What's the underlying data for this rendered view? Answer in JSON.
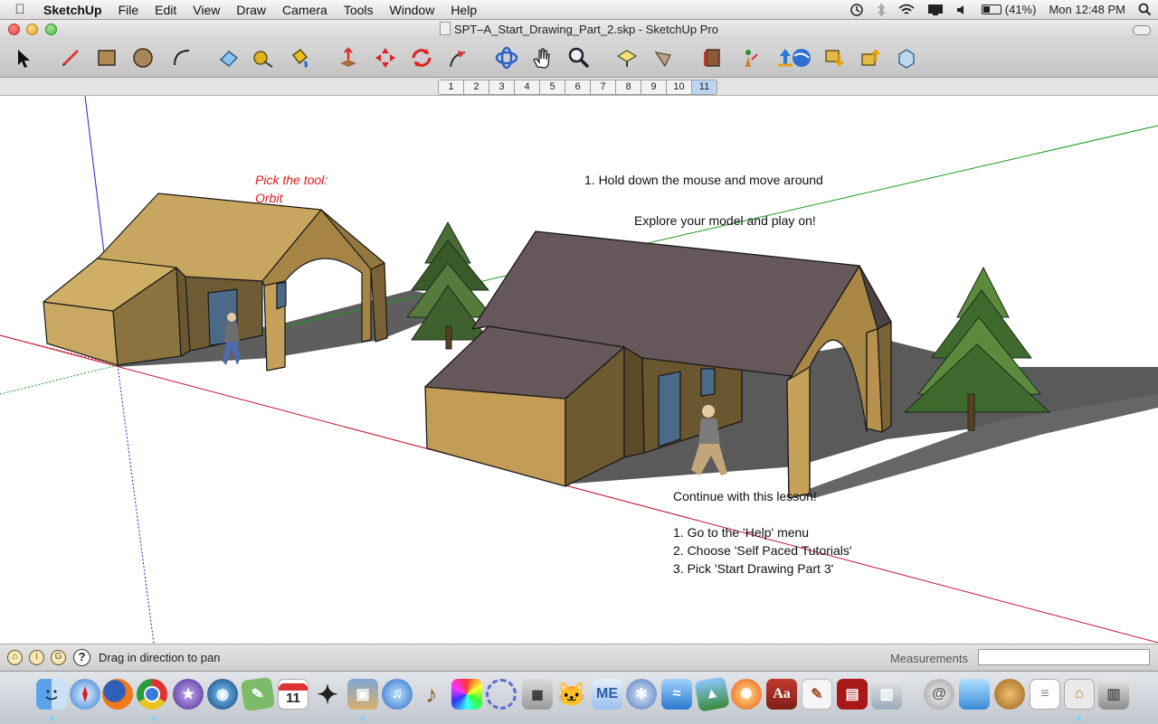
{
  "menubar": {
    "app_name": "SketchUp",
    "items": [
      "File",
      "Edit",
      "View",
      "Draw",
      "Camera",
      "Tools",
      "Window",
      "Help"
    ],
    "battery": "(41%)",
    "clock": "Mon 12:48 PM"
  },
  "window": {
    "title": "SPT–A_Start_Drawing_Part_2.skp - SketchUp Pro"
  },
  "toolbar": {
    "tools": [
      "select-tool",
      "pencil-tool",
      "rectangle-tool",
      "circle-tool",
      "arc-tool",
      "eraser-tool",
      "tape-measure-tool",
      "paint-bucket-tool",
      "push-pull-tool",
      "move-tool",
      "rotate-tool",
      "follow-me-tool",
      "orbit-tool",
      "pan-tool",
      "zoom-tool",
      "position-camera-tool",
      "walk-tool",
      "3d-warehouse",
      "get-models",
      "share-model",
      "component-get",
      "component-share",
      "component-ext"
    ]
  },
  "scenes": {
    "tabs": [
      "1",
      "2",
      "3",
      "4",
      "5",
      "6",
      "7",
      "8",
      "9",
      "10",
      "11"
    ],
    "active": "11"
  },
  "viewport": {
    "hint_line1": "Pick the tool:",
    "hint_line2": "Orbit",
    "instruction": "1. Hold down the mouse and move around",
    "explore": "Explore your model and play on!",
    "continue_title": "Continue with this lesson!",
    "steps": [
      "1. Go to the 'Help' menu",
      "2. Choose 'Self Paced Tutorials'",
      "3. Pick 'Start Drawing Part 3'"
    ],
    "colors": {
      "red_axis": "#c8102e",
      "green_axis": "#1a9a1a",
      "blue_axis": "#2222cc",
      "hint_text": "#e8161d",
      "roof_light": "#c8a863",
      "roof_dark": "#66585a",
      "wall": "#c39c55"
    }
  },
  "statusbar": {
    "message": "Drag in direction to pan",
    "measurements_label": "Measurements",
    "measurements_value": ""
  },
  "dock": {
    "apps": [
      "finder",
      "safari",
      "firefox",
      "chrome",
      "imovie",
      "dashboard",
      "maps",
      "calendar",
      "imovie-star",
      "iphoto",
      "itunes",
      "garageband",
      "color-picker",
      "network",
      "calculator",
      "scratch",
      "mindmanager",
      "mobileme",
      "edu-app",
      "earth",
      "sunburst",
      "dictionary",
      "textedit",
      "photo-booth",
      "preview",
      "disk-utility",
      "downloads",
      "acorn",
      "document",
      "sketchup-home",
      "trash"
    ],
    "calendar_day": "11",
    "dictionary_label": "Aa",
    "me_label": "ME"
  }
}
